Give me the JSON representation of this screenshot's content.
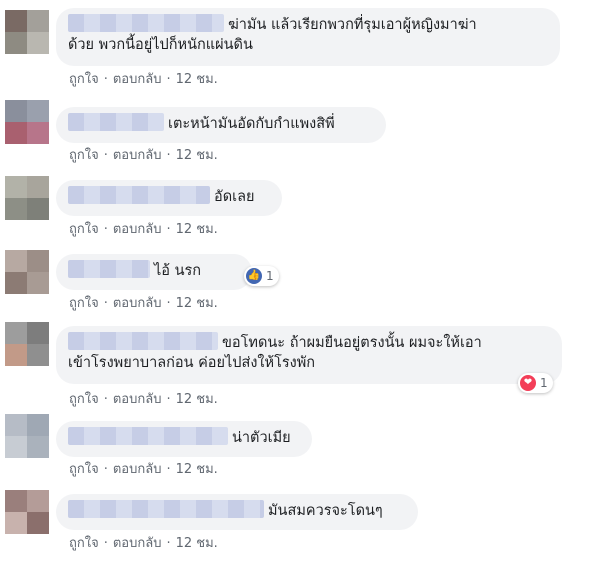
{
  "comments": [
    {
      "text": "ฆ่ามัน แล้วเรียกพวกที่รุมเอาผู้หญิงมาฆ่า\nด้วย พวกนี้อยู่ไปก็หนักแผ่นดิน",
      "like": "ถูกใจ",
      "reply": "ตอบกลับ",
      "time": "12 ชม.",
      "avatar_colors": [
        "#7a6a64",
        "#a3a09a",
        "#8e8b82",
        "#b9b7b0"
      ]
    },
    {
      "text": "เตะหน้ามันอัดกับกำแพงสิพี่",
      "like": "ถูกใจ",
      "reply": "ตอบกลับ",
      "time": "12 ชม.",
      "avatar_colors": [
        "#8a8f9c",
        "#9aa0ad",
        "#a9606f",
        "#b7758a"
      ]
    },
    {
      "text": "อัดเลย",
      "like": "ถูกใจ",
      "reply": "ตอบกลับ",
      "time": "12 ชม.",
      "avatar_colors": [
        "#b2b2a8",
        "#a8a59c",
        "#8d8f86",
        "#7e8079"
      ]
    },
    {
      "text": "ไอ้     นรก",
      "like": "ถูกใจ",
      "reply": "ตอบกลับ",
      "time": "12 ชม.",
      "reaction": {
        "count": "1",
        "type": "like",
        "color": "#4267b2"
      },
      "avatar_colors": [
        "#b7a9a2",
        "#9c8e87",
        "#8c7b74",
        "#a89b94"
      ]
    },
    {
      "text": "ขอโทดนะ ถ้าผมยืนอยู่ตรงนั้น ผมจะให้เอา\nเข้าโรงพยาบาลก่อน ค่อยไปส่งให้โรงพัก",
      "like": "ถูกใจ",
      "reply": "ตอบกลับ",
      "time": "12 ชม.",
      "reaction": {
        "count": "1",
        "type": "love",
        "color": "#f33e58"
      },
      "avatar_colors": [
        "#9d9d9d",
        "#7d7d7d",
        "#c29a88",
        "#8f8f8f"
      ]
    },
    {
      "text": "น่าตัวเมีย",
      "like": "ถูกใจ",
      "reply": "ตอบกลับ",
      "time": "12 ชม.",
      "avatar_colors": [
        "#b6bcc6",
        "#9fa8b4",
        "#c7ccd3",
        "#aab2bc"
      ]
    },
    {
      "text": "มันสมควรจะโดนๆ",
      "like": "ถูกใจ",
      "reply": "ตอบกลับ",
      "time": "12 ชม.",
      "avatar_colors": [
        "#9a7f7c",
        "#b49c98",
        "#c8b2ad",
        "#8b6f6c"
      ]
    }
  ]
}
